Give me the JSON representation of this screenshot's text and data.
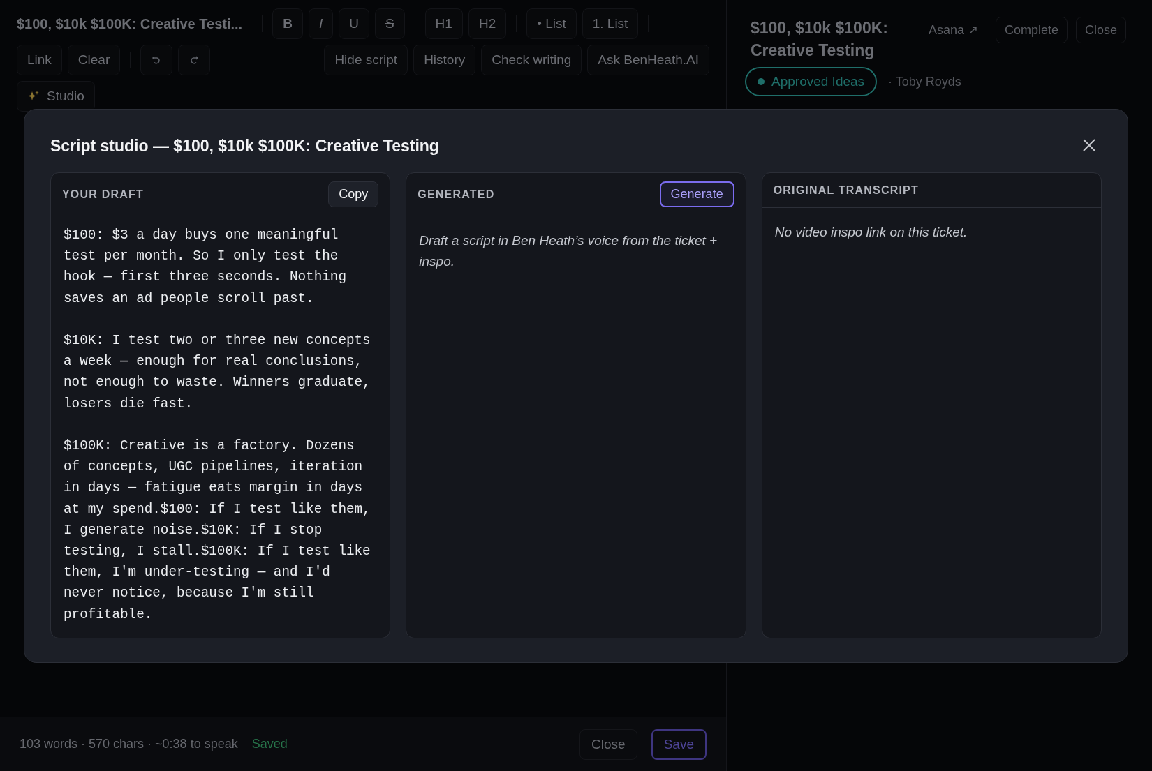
{
  "editor": {
    "title": "$100, $10k $100K: Creative Testi...",
    "format_buttons": [
      {
        "label": "B",
        "kind": "bold"
      },
      {
        "label": "I",
        "kind": "italic"
      },
      {
        "label": "U",
        "kind": "underline"
      },
      {
        "label": "S",
        "kind": "strike"
      }
    ],
    "heading_buttons": [
      "H1",
      "H2"
    ],
    "list_buttons": [
      "• List",
      "1. List"
    ],
    "edit_buttons": [
      "Link",
      "Clear"
    ],
    "action_buttons": [
      "Hide script",
      "History",
      "Check writing",
      "Ask BenHeath.AI"
    ],
    "studio_button": "Studio"
  },
  "ticket": {
    "title": "$100, $10k $100K: Creative Testing",
    "buttons": [
      {
        "label": "Asana ↗",
        "kind": "link"
      },
      {
        "label": "Complete",
        "kind": "button"
      },
      {
        "label": "Close",
        "kind": "button"
      }
    ],
    "status": {
      "label": "Approved Ideas",
      "color": "#1f6e69"
    },
    "assignee": "· Toby Royds"
  },
  "modal": {
    "title": "Script studio — $100, $10k $100K: Creative Testing",
    "panes": [
      {
        "heading": "YOUR DRAFT",
        "button": {
          "label": "Copy",
          "primary": false
        },
        "kind": "draft",
        "text": "$100: $3 a day buys one meaningful test per month. So I only test the hook — first three seconds. Nothing saves an ad people scroll past.\n\n$10K: I test two or three new concepts a week — enough for real conclusions, not enough to waste. Winners graduate, losers die fast.\n\n$100K: Creative is a factory. Dozens of concepts, UGC pipelines, iteration in days — fatigue eats margin in days at my spend.$100: If I test like them, I generate noise.$10K: If I stop testing, I stall.$100K: If I test like them, I'm under-testing — and I'd never notice, because I'm still profitable."
      },
      {
        "heading": "GENERATED",
        "button": {
          "label": "Generate",
          "primary": true
        },
        "kind": "hint",
        "text": "Draft a script in Ben Heath’s voice from the ticket + inspo."
      },
      {
        "heading": "ORIGINAL TRANSCRIPT",
        "kind": "hint",
        "text": "No video inspo link on this ticket."
      }
    ]
  },
  "footer": {
    "stats": "103 words · 570 chars · ~0:38 to speak",
    "save_state": "Saved",
    "buttons": [
      {
        "label": "Close",
        "primary": false
      },
      {
        "label": "Save",
        "primary": true
      }
    ]
  }
}
